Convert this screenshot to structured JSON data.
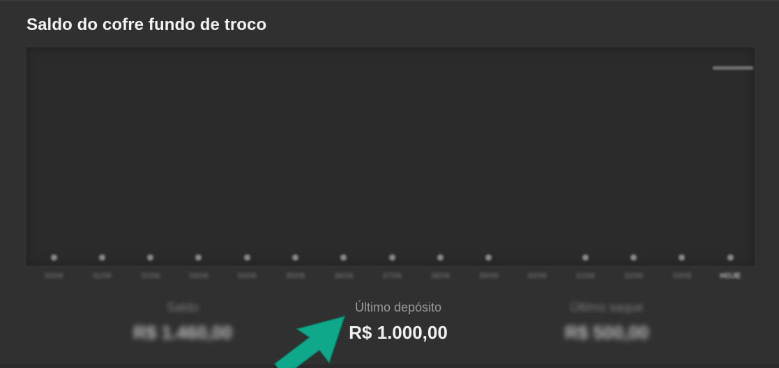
{
  "card": {
    "title": "Saldo do cofre fundo de troco"
  },
  "chart": {
    "x_ticks": [
      "30/06",
      "31/06",
      "32/06",
      "33/06",
      "34/06",
      "35/06",
      "36/06",
      "37/06",
      "38/06",
      "39/06",
      "30/06",
      "31/06",
      "32/06",
      "33/06",
      "HOJE"
    ],
    "dots_visible": [
      true,
      true,
      true,
      true,
      true,
      true,
      true,
      true,
      true,
      true,
      false,
      true,
      true,
      true,
      true
    ]
  },
  "stats": {
    "balance": {
      "label": "Saldo",
      "value": "R$ 1.460,00"
    },
    "last_deposit": {
      "label": "Último depósito",
      "value": "R$ 1.000,00"
    },
    "last_withdrawal": {
      "label": "Último saque",
      "value": "R$ 500,00"
    }
  },
  "colors": {
    "annotation_arrow": "#10a88a",
    "card_background": "#303030"
  },
  "icons": {
    "annotation": "arrow-pointer-icon"
  }
}
